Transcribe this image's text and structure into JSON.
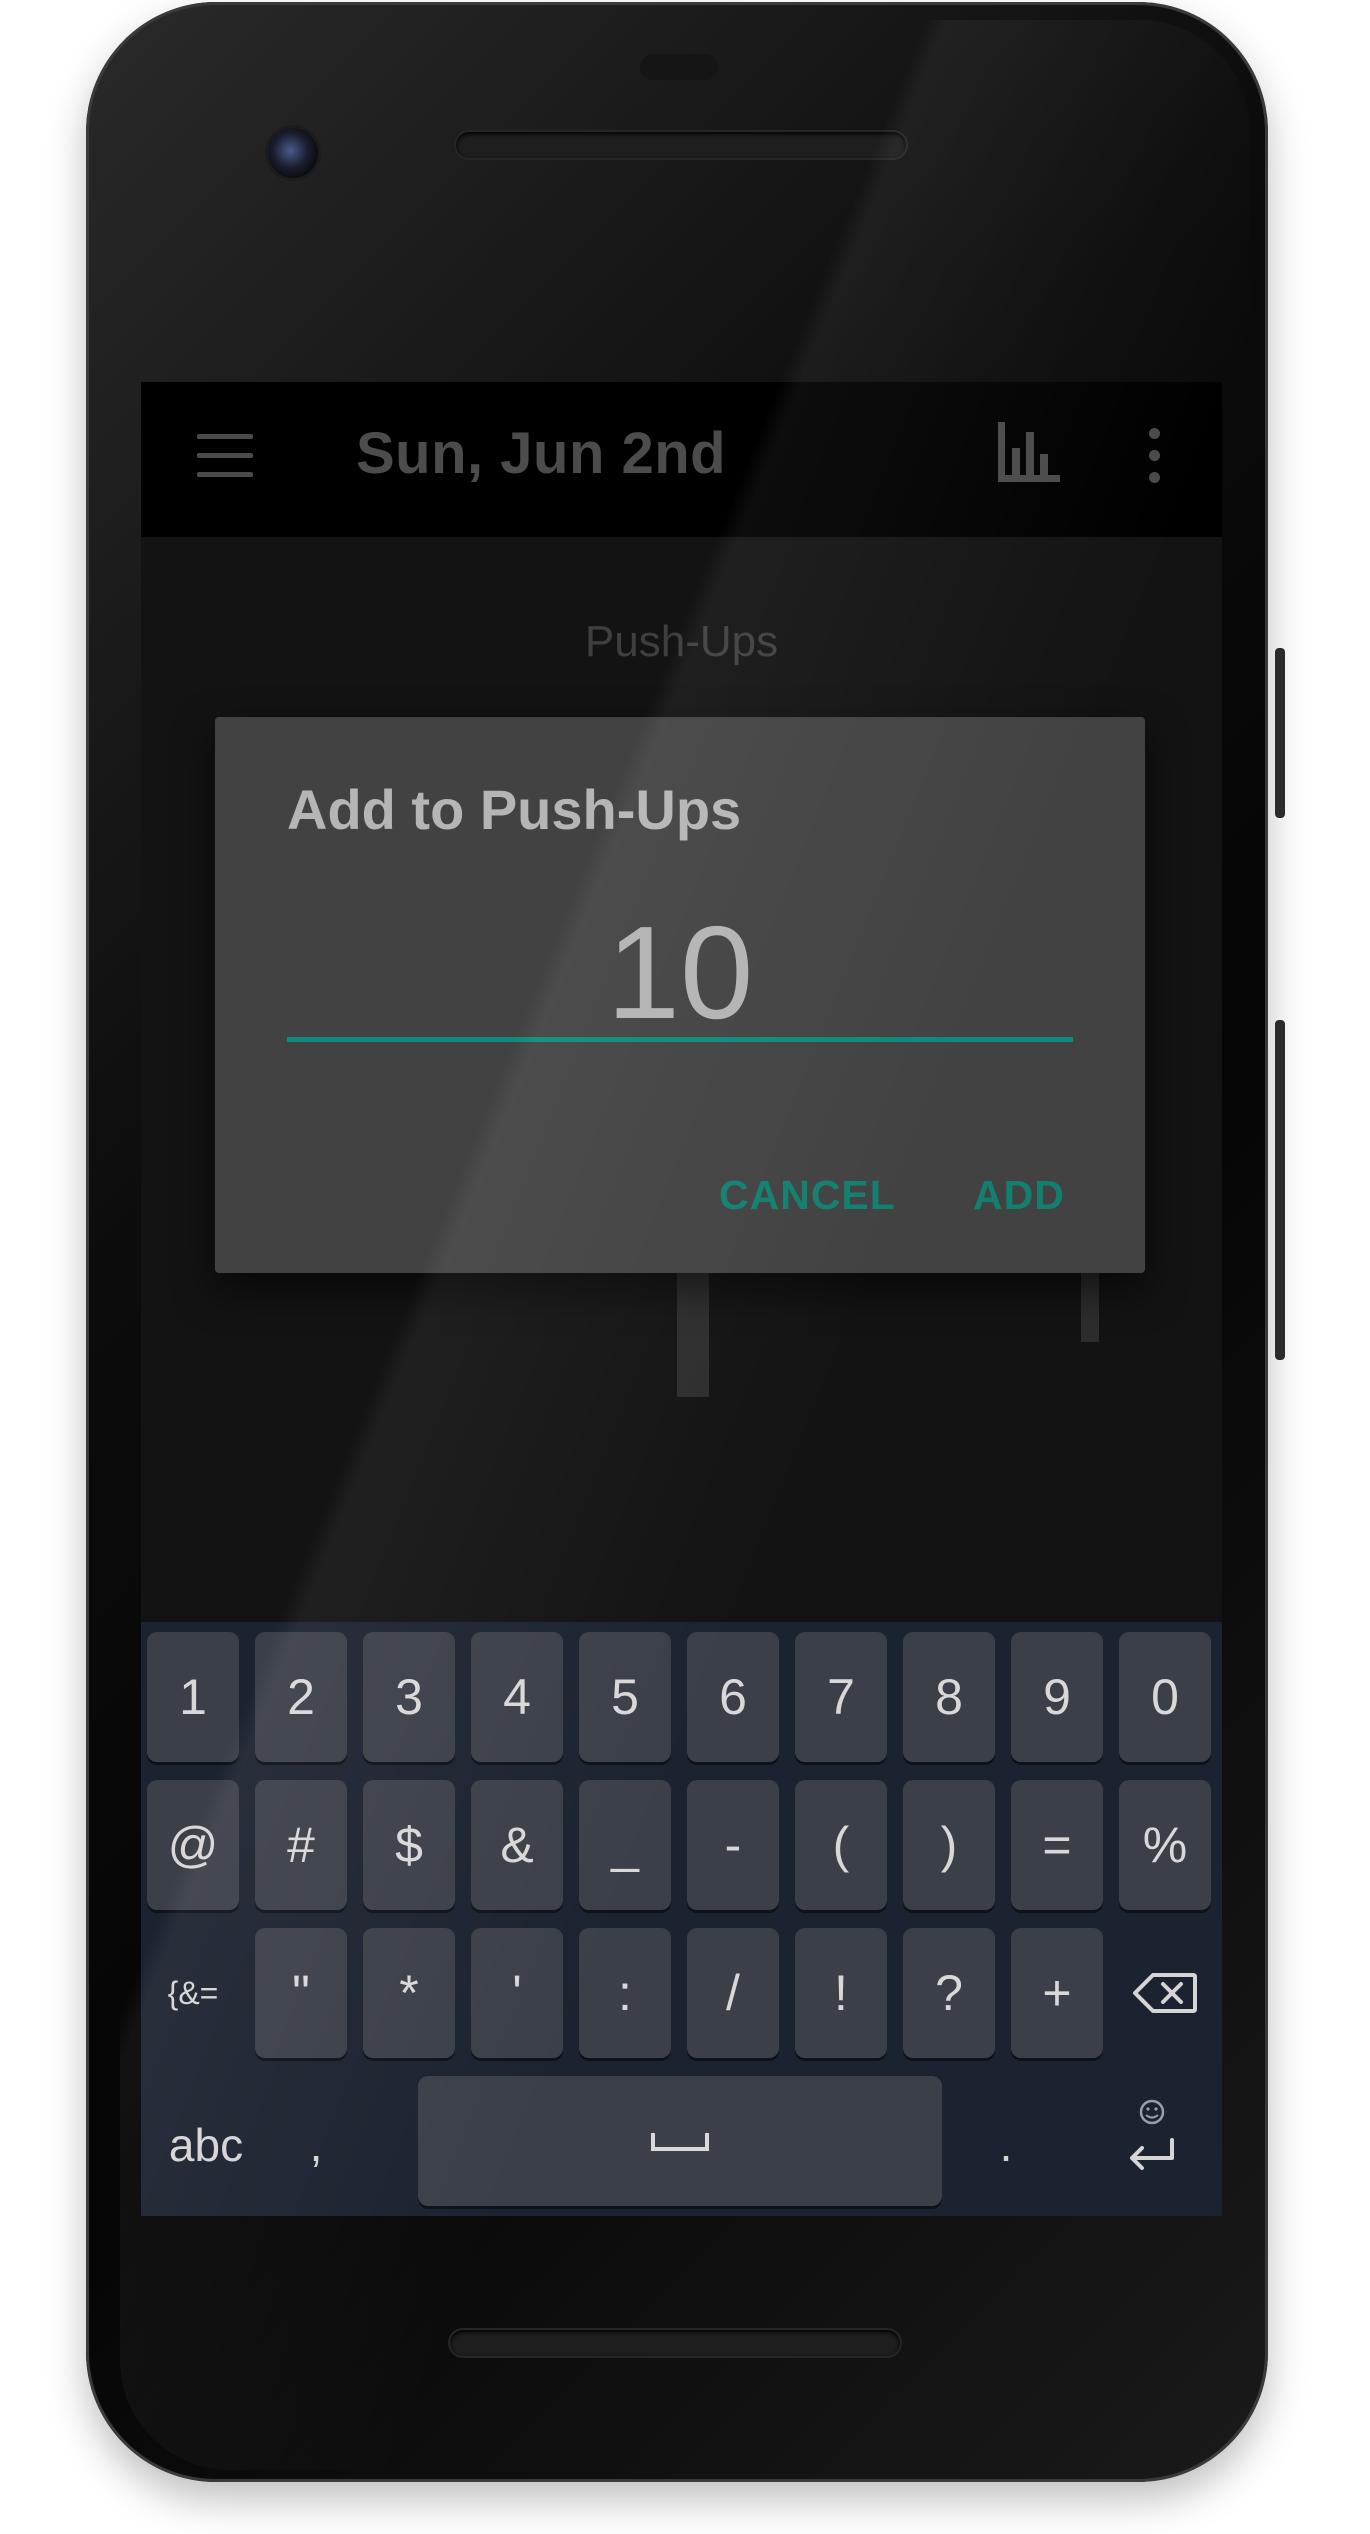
{
  "app_bar": {
    "title": "Sun, Jun 2nd",
    "menu_icon": "hamburger-menu-icon",
    "chart_icon": "bar-chart-icon",
    "more_icon": "more-vert-icon"
  },
  "content": {
    "counter_name": "Push-Ups"
  },
  "dialog": {
    "title": "Add to Push-Ups",
    "value": "10",
    "cancel_label": "CANCEL",
    "add_label": "ADD",
    "accent_color": "#0f8a7e"
  },
  "keyboard": {
    "row1": [
      "1",
      "2",
      "3",
      "4",
      "5",
      "6",
      "7",
      "8",
      "9",
      "0"
    ],
    "row2": [
      "@",
      "#",
      "$",
      "&",
      "_",
      "-",
      "(",
      ")",
      "=",
      "%"
    ],
    "row3_switch": "{&=",
    "row3": [
      "\"",
      "*",
      "'",
      ":",
      "/",
      "!",
      "?",
      "+"
    ],
    "backspace_icon": "backspace-icon",
    "abc": "abc",
    "comma": ",",
    "space_icon": "space-icon",
    "period": ".",
    "emoji_icon": "emoji-icon",
    "enter_icon": "enter-icon"
  }
}
